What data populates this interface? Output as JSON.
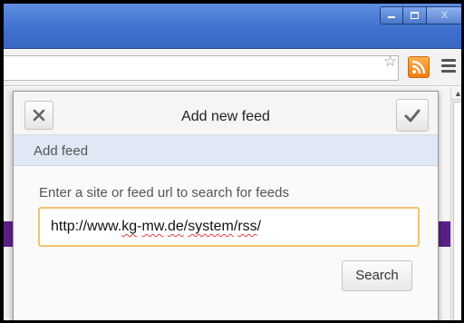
{
  "window": {
    "minimize_icon": "minimize-icon",
    "maximize_icon": "maximize-icon",
    "close_label": "X"
  },
  "toolbar": {
    "bookmark_icon": "star-icon",
    "rss_icon": "rss-icon",
    "menu_icon": "hamburger-menu-icon",
    "rss_color": "#f07b12"
  },
  "popup": {
    "title": "Add new feed",
    "cancel_icon": "close-icon",
    "confirm_icon": "checkmark-icon",
    "section_label": "Add feed",
    "search_label": "Enter a site or feed url to search for feeds",
    "url_parts": [
      "http://www.",
      "kg",
      "-",
      "mw",
      ".",
      "de",
      "/",
      "system",
      "/",
      "rss",
      "/"
    ],
    "url_value": "http://www.kg-mw.de/system/rss/",
    "search_button": "Search",
    "input_border_color": "#f0c36d",
    "section_bg_color": "#dfe8f4"
  }
}
